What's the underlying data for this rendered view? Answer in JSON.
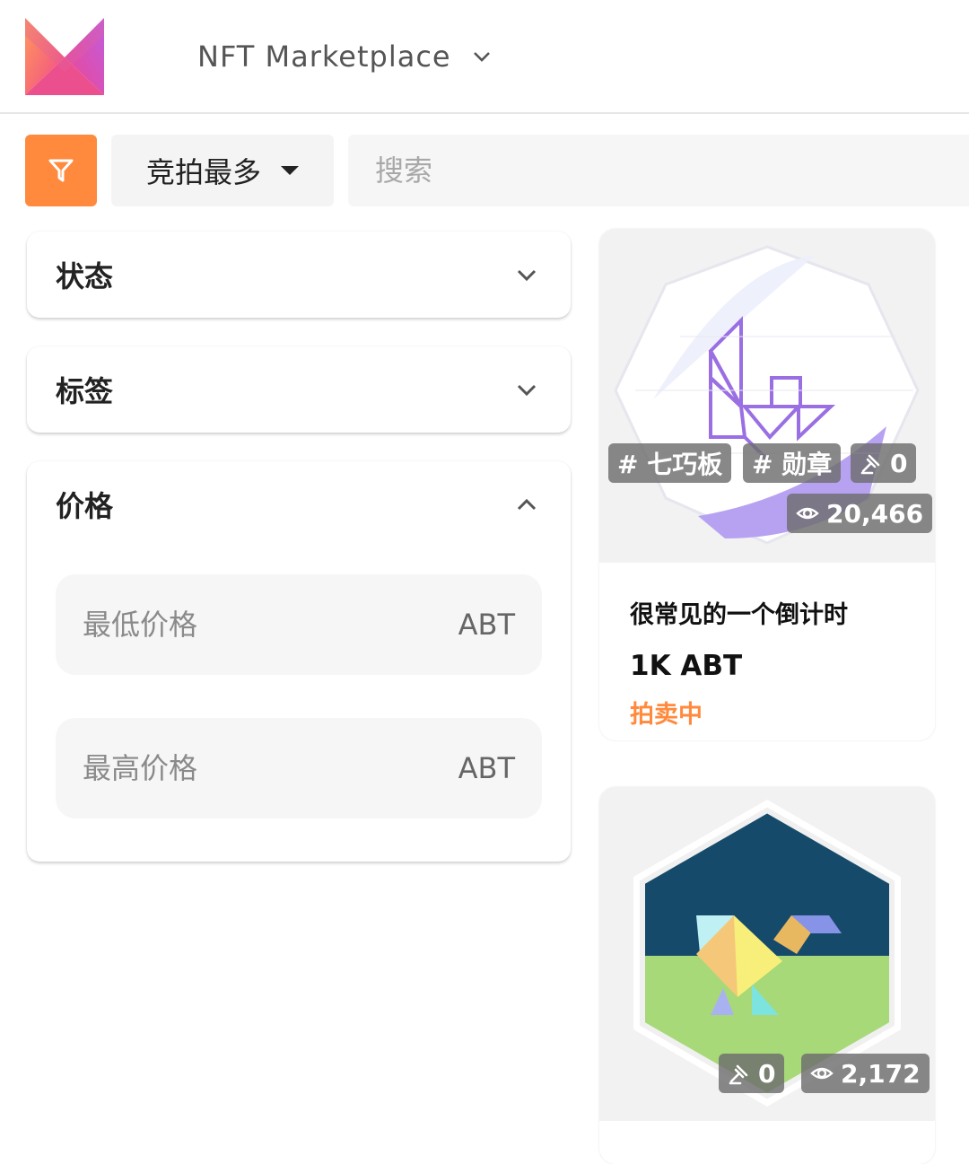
{
  "header": {
    "app_title": "NFT Marketplace",
    "icons": {
      "logo": "marketplace-logo",
      "switch": "chevron-down-icon"
    }
  },
  "toolbar": {
    "filter_icon": "filter-icon",
    "sort_label": "竞拍最多",
    "search_placeholder": "搜索"
  },
  "filters": {
    "status_title": "状态",
    "tags_title": "标签",
    "price_title": "价格",
    "min_price_placeholder": "最低价格",
    "max_price_placeholder": "最高价格",
    "unit": "ABT"
  },
  "cards": [
    {
      "tags": [
        "# 七巧板",
        "# 勋章"
      ],
      "bids": "0",
      "views": "20,466",
      "name": "很常见的一个倒计时",
      "price": "1K ABT",
      "status": "拍卖中"
    },
    {
      "bids": "0",
      "views": "2,172"
    }
  ],
  "colors": {
    "accent": "#ff8a3d",
    "night": "#154a6b",
    "grass": "#a7d978"
  }
}
